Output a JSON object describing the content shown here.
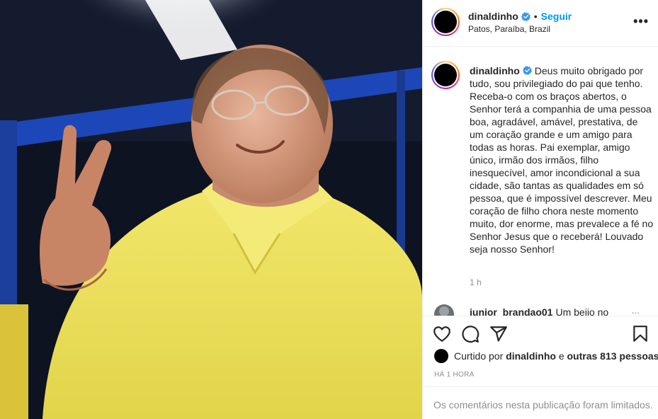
{
  "post": {
    "username": "dinaldinho",
    "follow_label": "Seguir",
    "separator": "•",
    "location": "Patos, Paraíba, Brazil",
    "more_label": "•••",
    "caption": "Deus muito obrigado por tudo, sou privilegiado do pai que tenho. Receba-o com os braços abertos, o Senhor terá a companhia de uma pessoa boa, agradável, amável, prestativa, de um coração grande e um amigo para todas as horas. Pai exemplar, amigo único, irmão dos irmãos, filho inesquecível, amor incondicional a sua cidade, são tantas as qualidades em só pessoa, que é impossível descrever. Meu coração de filho chora neste momento muito, dor enorme, mas prevalece a fé no Senhor Jesus que o receberá! Louvado seja nosso Senhor!",
    "caption_time": "1 h"
  },
  "comment_peek": {
    "username": "junior_brandao01",
    "text": "Um beijo no",
    "more": "..."
  },
  "likes": {
    "prefix": "Curtido por",
    "user": "dinaldinho",
    "connector": "e",
    "others": "outras 813 pessoas"
  },
  "timestamp": "HÁ 1 HORA",
  "footer": {
    "limited_notice": "Os comentários nesta publicação foram limitados."
  },
  "colors": {
    "link_blue": "#0095f6",
    "verified_blue": "#3897f0",
    "muted": "#8e8e8e"
  },
  "icons": {
    "like": "heart-icon",
    "comment": "comment-icon",
    "share": "paper-plane-icon",
    "save": "bookmark-icon",
    "verified": "verified-badge-icon",
    "more": "more-options-icon"
  }
}
